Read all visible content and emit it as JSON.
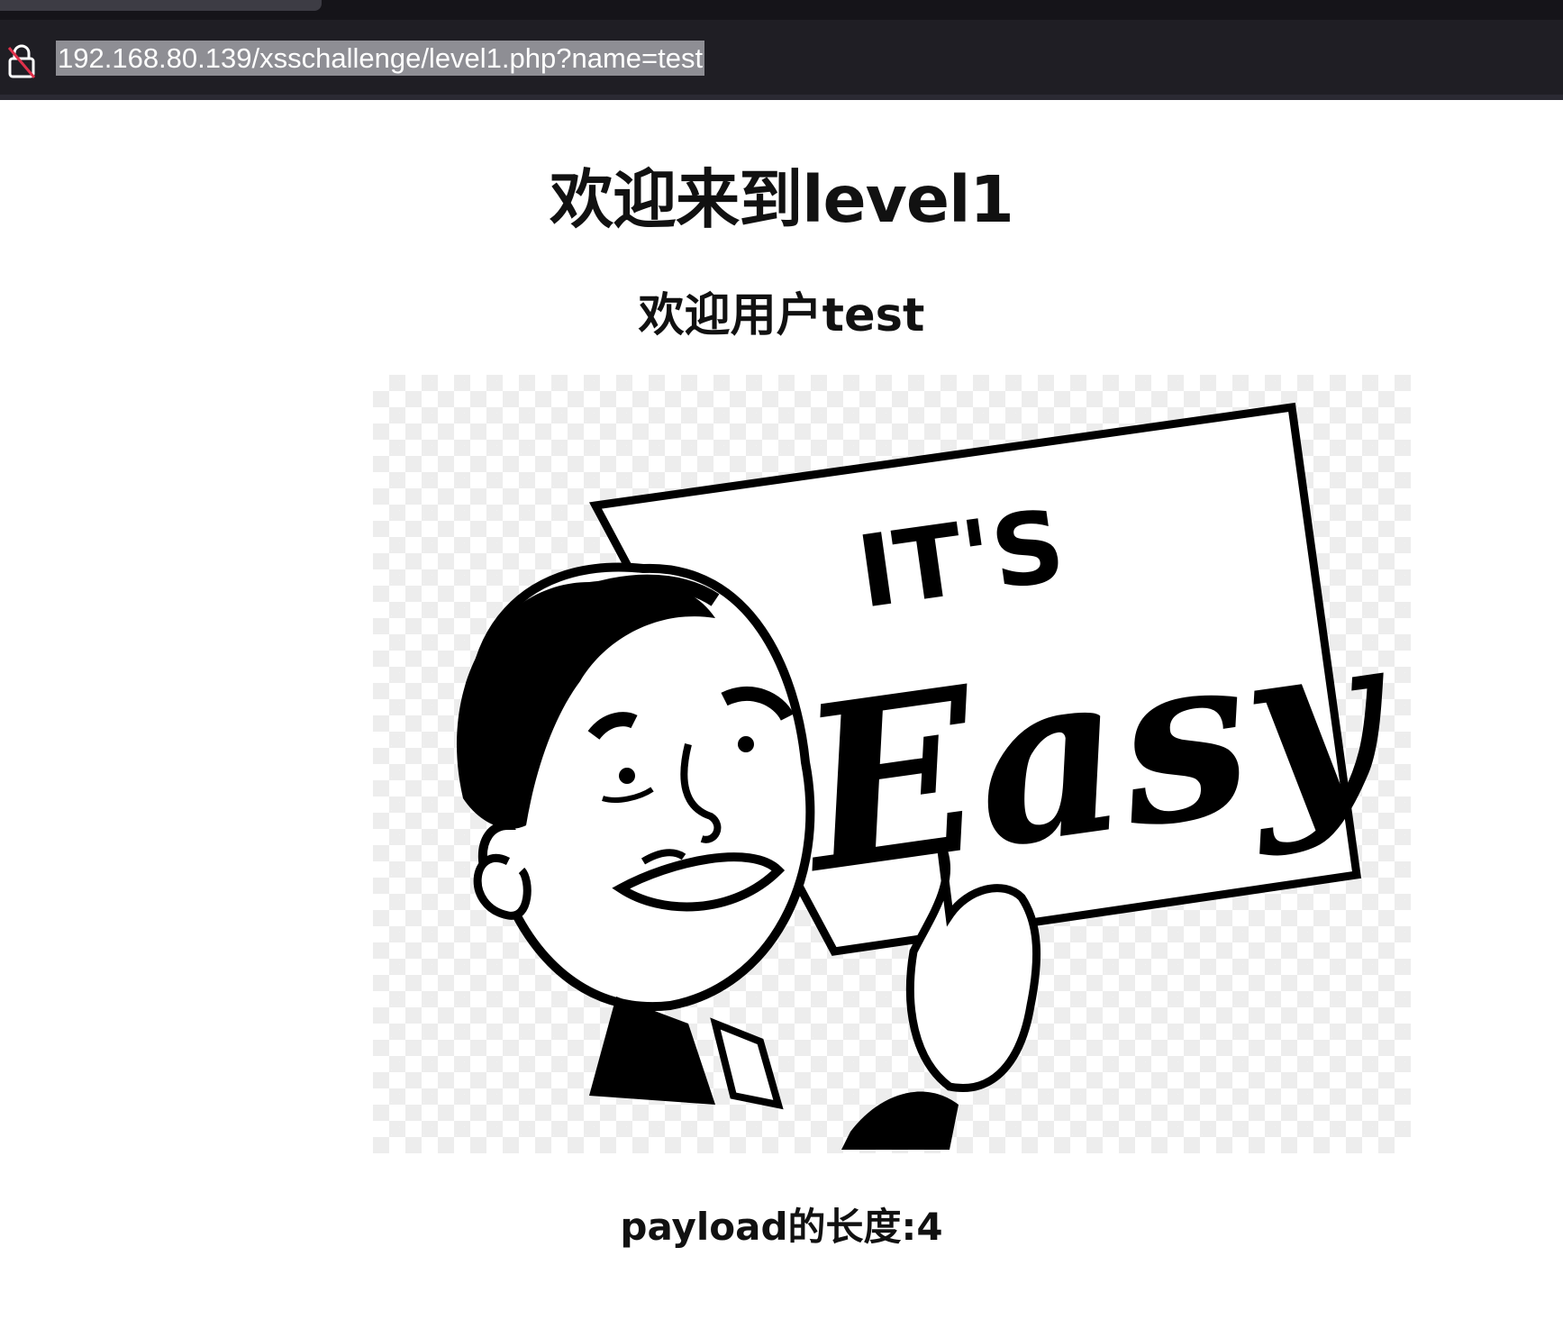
{
  "browser": {
    "url": "192.168.80.139/xsschallenge/level1.php?name=test",
    "lock_icon": "insecure-lock-icon"
  },
  "page": {
    "title": "欢迎来到level1",
    "welcome": "欢迎用户test",
    "image": {
      "sign_line1": "IT'S",
      "sign_line2": "Easy"
    },
    "payload_length": "payload的长度:4"
  },
  "colors": {
    "chrome_bg": "#1f1e24",
    "url_highlight": "#8e8e94",
    "page_bg": "#ffffff",
    "text": "#111111"
  }
}
